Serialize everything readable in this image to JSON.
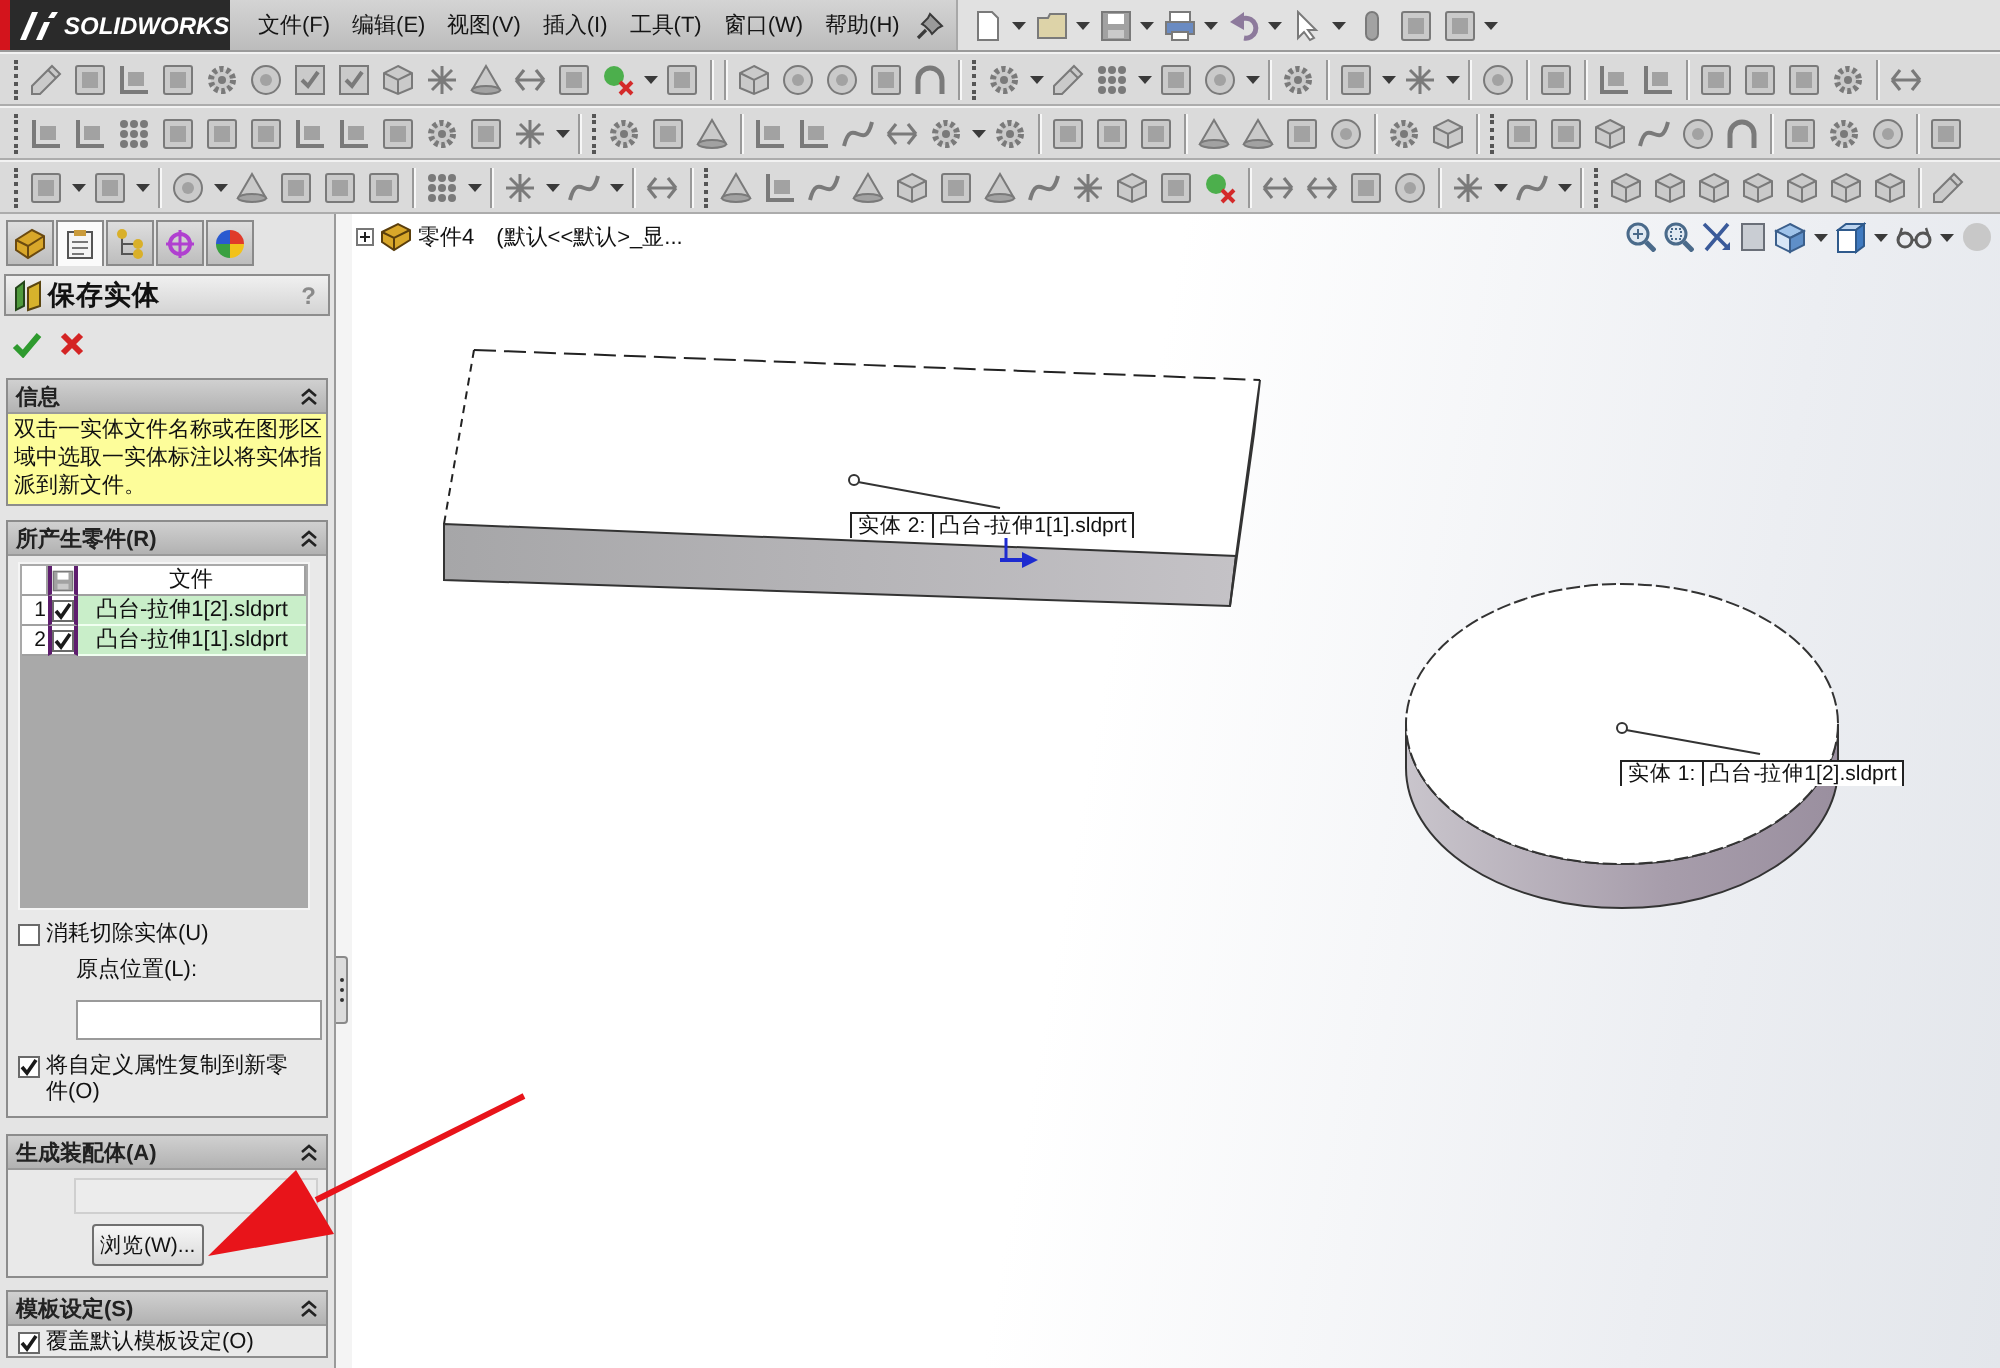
{
  "menu_bar": {
    "logo": "SOLIDWORKS",
    "items": [
      "文件(F)",
      "编辑(E)",
      "视图(V)",
      "插入(I)",
      "工具(T)",
      "窗口(W)",
      "帮助(H)"
    ]
  },
  "property_manager": {
    "tabs": [
      {
        "kind": "features",
        "selected": false
      },
      {
        "kind": "properties",
        "selected": true
      },
      {
        "kind": "configurations",
        "selected": false
      },
      {
        "kind": "dimxpert",
        "selected": false
      },
      {
        "kind": "display",
        "selected": false
      }
    ],
    "title": "保存实体",
    "help": "?",
    "info": {
      "heading": "信息",
      "expanded": true,
      "message": "双击一实体文件名称或在图形区域中选取一实体标注以将实体指派到新文件。"
    },
    "resulting_parts": {
      "heading": "所产生零件(R)",
      "expanded": true,
      "columns": [
        "文件"
      ],
      "rows": [
        {
          "number": "1",
          "checked": true,
          "file": "凸台-拉伸1[2].sldprt"
        },
        {
          "number": "2",
          "checked": true,
          "file": "凸台-拉伸1[1].sldprt"
        }
      ],
      "consume_cut": {
        "label": "消耗切除实体(U)",
        "checked": false
      },
      "origin": {
        "label": "原点位置(L):"
      },
      "copy_properties": {
        "label": "将自定义属性复制到新零件(O)",
        "checked": true
      }
    },
    "assembly": {
      "heading": "生成装配体(A)",
      "expanded": true,
      "path_field": {
        "disabled": true
      },
      "browse_button": "浏览(W)..."
    },
    "template": {
      "heading": "模板设定(S)",
      "expanded": true,
      "override": {
        "label": "覆盖默认模板设定(O)",
        "checked": true
      }
    }
  },
  "graphics": {
    "tree_item": {
      "expanded": false,
      "name": "零件4",
      "configuration": "(默认<<默认>_显..."
    },
    "bodies": [
      {
        "kind": "slab",
        "tag": "实体 2:",
        "file": "凸台-拉伸1[1].sldprt"
      },
      {
        "kind": "cylinder",
        "tag": "实体 1:",
        "file": "凸台-拉伸1[2].sldprt"
      }
    ]
  }
}
